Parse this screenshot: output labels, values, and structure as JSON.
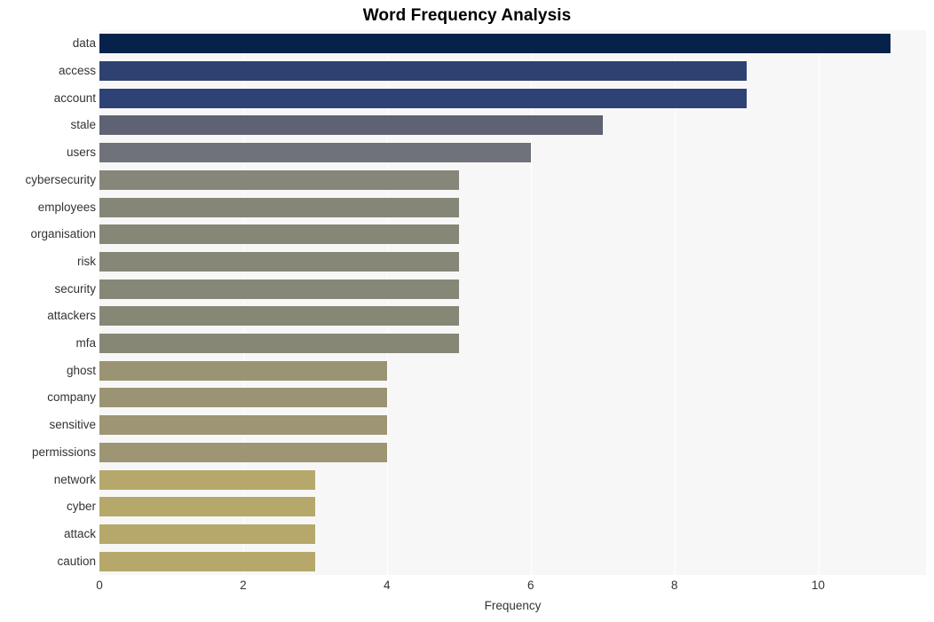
{
  "chart_data": {
    "type": "bar",
    "orientation": "horizontal",
    "title": "Word Frequency Analysis",
    "xlabel": "Frequency",
    "ylabel": "",
    "categories": [
      "data",
      "access",
      "account",
      "stale",
      "users",
      "cybersecurity",
      "employees",
      "organisation",
      "risk",
      "security",
      "attackers",
      "mfa",
      "ghost",
      "company",
      "sensitive",
      "permissions",
      "network",
      "cyber",
      "attack",
      "caution"
    ],
    "values": [
      11,
      9,
      9,
      7,
      6,
      5,
      5,
      5,
      5,
      5,
      5,
      5,
      4,
      4,
      4,
      4,
      3,
      3,
      3,
      3
    ],
    "xticks": [
      0,
      2,
      4,
      6,
      8,
      10
    ],
    "xlim": [
      0,
      11.5
    ],
    "grid": "vertical-only",
    "legend": "none",
    "bar_colors": [
      "#06214a",
      "#2e4272",
      "#2f4276",
      "#5e6272",
      "#70727a",
      "#86867a",
      "#868678",
      "#878778",
      "#878778",
      "#878778",
      "#878776",
      "#878776",
      "#9b9474",
      "#9b9474",
      "#9d9573",
      "#9d9573",
      "#b5a86a",
      "#b5a86a",
      "#b5a86a",
      "#b5a86a"
    ],
    "plot_background": "#f7f7f7",
    "figure_background": "#ffffff",
    "gridline_color": "#ffffff",
    "title_color": "#000000",
    "tick_label_color": "#333333"
  }
}
